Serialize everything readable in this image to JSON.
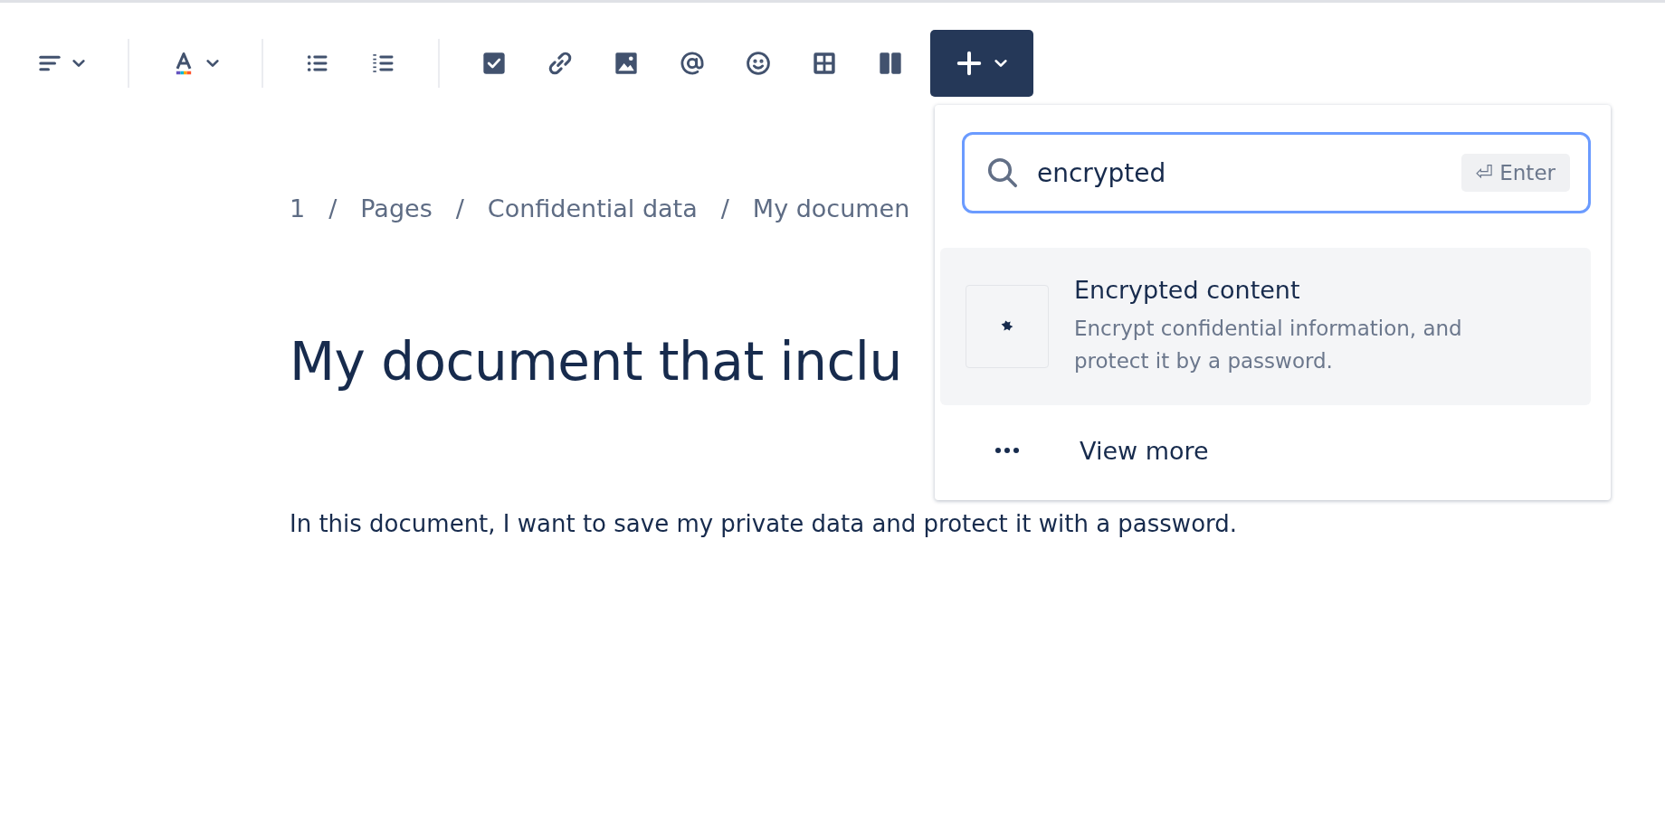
{
  "insert_button": {
    "expanded": true
  },
  "insert_menu": {
    "search": {
      "value": "encrypted",
      "shortcut": "⏎ Enter"
    },
    "results": [
      {
        "title": "Encrypted content",
        "description": "Encrypt confidential information, and protect it by a password.",
        "selected": true
      }
    ],
    "view_more": {
      "label": "View more"
    }
  },
  "page": {
    "breadcrumb_separator": "/",
    "breadcrumbs": [
      "1",
      "Pages",
      "Confidential data",
      "My documen"
    ],
    "title": "My document that inclu",
    "body": "In this document, I want to save my private data and protect it with a password."
  }
}
